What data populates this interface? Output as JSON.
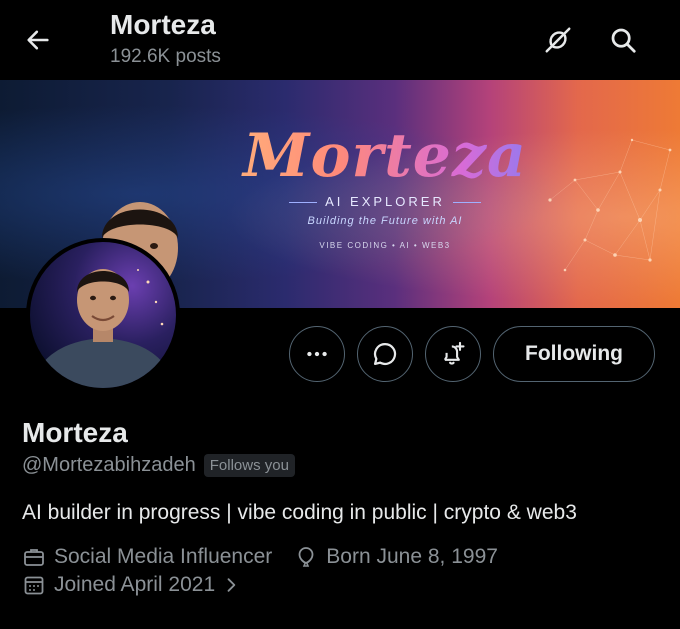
{
  "header": {
    "name": "Morteza",
    "posts": "192.6K posts"
  },
  "banner": {
    "title": "Morteza",
    "subtitle": "AI EXPLORER",
    "tagline": "Building the Future with AI",
    "tags": "VIBE CODING  •  AI  •  WEB3"
  },
  "actions": {
    "following_label": "Following"
  },
  "profile": {
    "display_name": "Morteza",
    "handle": "@Mortezabihzadeh",
    "follows_badge": "Follows you",
    "bio": "AI builder in progress | vibe coding in public | crypto & web3",
    "category": "Social Media Influencer",
    "born": "Born June 8, 1997",
    "joined": "Joined April 2021"
  },
  "icons": {
    "back": "arrow-left-icon",
    "cast": "no-sync-icon",
    "search": "search-icon",
    "more": "more-icon",
    "message": "message-icon",
    "notify": "bell-plus-icon",
    "category": "briefcase-icon",
    "born": "balloon-icon",
    "joined": "calendar-icon"
  },
  "colors": {
    "background": "#000000",
    "primary_text": "#e7e9ea",
    "secondary_text": "#8b9196",
    "button_border": "#536471"
  }
}
